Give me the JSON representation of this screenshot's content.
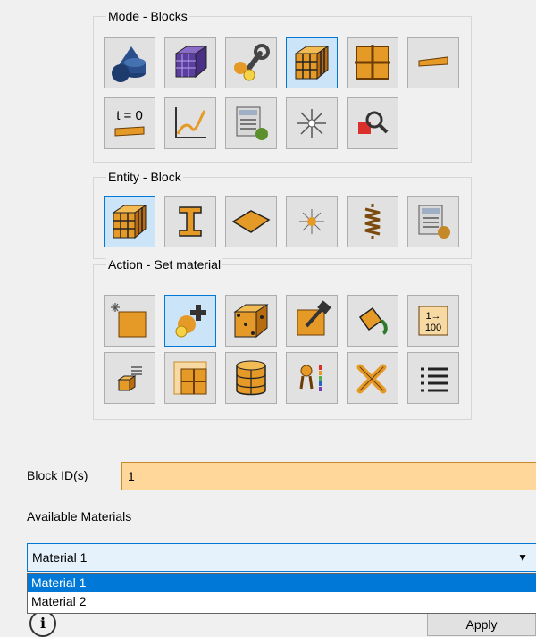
{
  "mode_group": {
    "title": "Mode - Blocks",
    "icons": [
      "geometry-icon",
      "mesh-icon",
      "mesh-tools-icon",
      "blocks-icon",
      "grid-icon",
      "curves-icon",
      "initial-conditions-icon",
      "functions-icon",
      "simulation-setup-icon",
      "lighting-icon",
      "inspect-icon"
    ],
    "time_label": "t = 0"
  },
  "entity_group": {
    "title": "Entity - Block",
    "icons": [
      "block-entity-icon",
      "beam-entity-icon",
      "shell-entity-icon",
      "point-entity-icon",
      "spring-entity-icon",
      "properties-entity-icon"
    ]
  },
  "action_group": {
    "title": "Action - Set material",
    "icons": [
      "create-block-icon",
      "set-material-icon",
      "block-elements-icon",
      "modify-block-icon",
      "paint-block-icon",
      "renumber-icon",
      "list-blocks-icon",
      "split-block-icon",
      "volume-block-icon",
      "attributes-icon",
      "delete-block-icon",
      "list-view-icon"
    ],
    "renumber_text": "1→ 100"
  },
  "form": {
    "block_ids_label": "Block ID(s)",
    "block_ids_value": "1",
    "available_materials_label": "Available Materials",
    "selected_material": "Material 1",
    "options": [
      "Material 1",
      "Material 2"
    ],
    "apply_label": "Apply",
    "info_symbol": "i"
  },
  "colors": {
    "accent": "#0078d7",
    "highlight_field": "#ffd79a",
    "block_orange": "#e59a28"
  }
}
